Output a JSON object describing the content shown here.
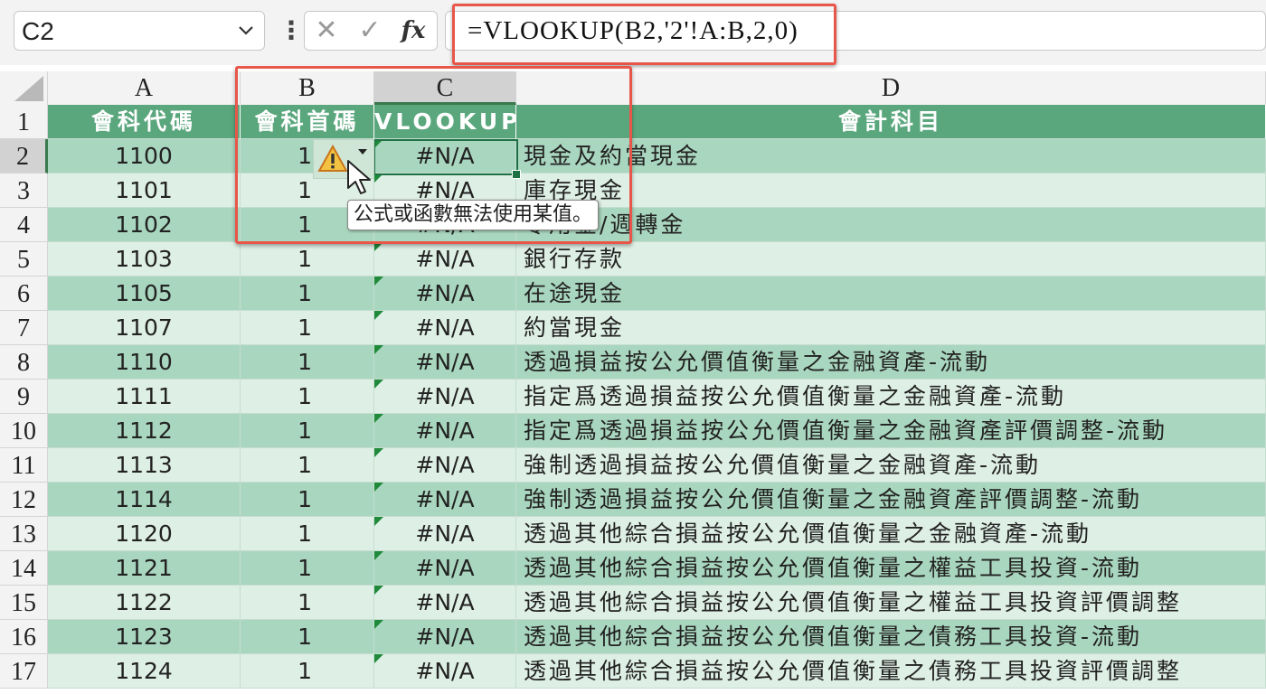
{
  "formula_bar": {
    "name_box": "C2",
    "cancel_symbol": "✕",
    "enter_symbol": "✓",
    "fx_label": "fx",
    "formula": "=VLOOKUP(B2,'2'!A:B,2,0)"
  },
  "columns": [
    "A",
    "B",
    "C",
    "D"
  ],
  "header_row": {
    "row_number": "1",
    "a": "會科代碼",
    "b": "會科首碼",
    "c": "VLOOKUP",
    "d": "會計科目"
  },
  "rows": [
    {
      "n": "2",
      "a": "1100",
      "b": "1",
      "c": "#N/A",
      "d": "現金及約當現金"
    },
    {
      "n": "3",
      "a": "1101",
      "b": "1",
      "c": "#N/A",
      "d": "庫存現金"
    },
    {
      "n": "4",
      "a": "1102",
      "b": "1",
      "c": "#N/A",
      "d": "零用金/週轉金"
    },
    {
      "n": "5",
      "a": "1103",
      "b": "1",
      "c": "#N/A",
      "d": "銀行存款"
    },
    {
      "n": "6",
      "a": "1105",
      "b": "1",
      "c": "#N/A",
      "d": "在途現金"
    },
    {
      "n": "7",
      "a": "1107",
      "b": "1",
      "c": "#N/A",
      "d": "約當現金"
    },
    {
      "n": "8",
      "a": "1110",
      "b": "1",
      "c": "#N/A",
      "d": "透過損益按公允價值衡量之金融資產-流動"
    },
    {
      "n": "9",
      "a": "1111",
      "b": "1",
      "c": "#N/A",
      "d": "指定爲透過損益按公允價值衡量之金融資產-流動"
    },
    {
      "n": "10",
      "a": "1112",
      "b": "1",
      "c": "#N/A",
      "d": "指定爲透過損益按公允價值衡量之金融資產評價調整-流動"
    },
    {
      "n": "11",
      "a": "1113",
      "b": "1",
      "c": "#N/A",
      "d": "強制透過損益按公允價值衡量之金融資產-流動"
    },
    {
      "n": "12",
      "a": "1114",
      "b": "1",
      "c": "#N/A",
      "d": "強制透過損益按公允價值衡量之金融資產評價調整-流動"
    },
    {
      "n": "13",
      "a": "1120",
      "b": "1",
      "c": "#N/A",
      "d": "透過其他綜合損益按公允價值衡量之金融資產-流動"
    },
    {
      "n": "14",
      "a": "1121",
      "b": "1",
      "c": "#N/A",
      "d": "透過其他綜合損益按公允價值衡量之權益工具投資-流動"
    },
    {
      "n": "15",
      "a": "1122",
      "b": "1",
      "c": "#N/A",
      "d": "透過其他綜合損益按公允價值衡量之權益工具投資評價調整"
    },
    {
      "n": "16",
      "a": "1123",
      "b": "1",
      "c": "#N/A",
      "d": "透過其他綜合損益按公允價值衡量之債務工具投資-流動"
    },
    {
      "n": "17",
      "a": "1124",
      "b": "1",
      "c": "#N/A",
      "d": "透過其他綜合損益按公允價值衡量之債務工具投資評價調整"
    }
  ],
  "error_tooltip": "公式或函數無法使用某值。",
  "icons": {
    "warning": "warning-triangle-icon",
    "dropdown": "chevron-down-icon",
    "cursor": "mouse-pointer-icon"
  },
  "colors": {
    "header_green": "#5aa77d",
    "band_green": "#a9d6be",
    "light_green": "#deefe5",
    "highlight_red": "#e8564a",
    "selection_green": "#1e7145"
  }
}
